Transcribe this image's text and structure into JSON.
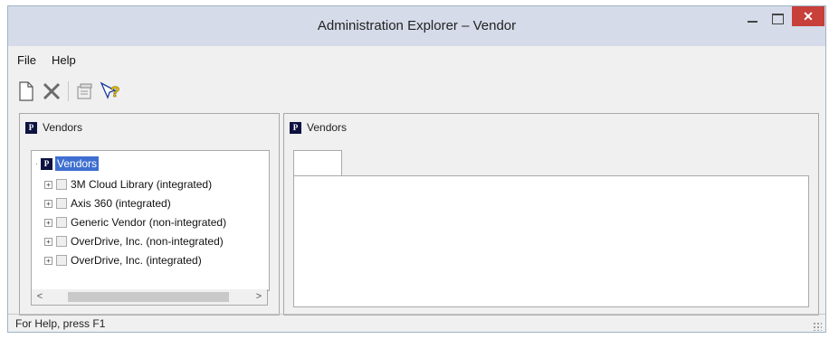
{
  "window": {
    "title": "Administration Explorer – Vendor"
  },
  "menu": {
    "items": [
      "File",
      "Help"
    ]
  },
  "toolbar": {
    "buttons": [
      "new-icon",
      "delete-icon",
      "properties-icon",
      "help-pointer-icon"
    ]
  },
  "left_pane": {
    "header": "Vendors",
    "tree": {
      "root": "Vendors",
      "items": [
        "3M Cloud Library (integrated)",
        "Axis 360 (integrated)",
        "Generic Vendor (non-integrated)",
        "OverDrive, Inc. (non-integrated)",
        "OverDrive, Inc. (integrated)"
      ]
    }
  },
  "right_pane": {
    "header": "Vendors"
  },
  "status": {
    "text": "For Help, press F1"
  },
  "colors": {
    "selection": "#3e6fd1",
    "close_button": "#c7403a",
    "icon_dark": "#0e1240"
  }
}
